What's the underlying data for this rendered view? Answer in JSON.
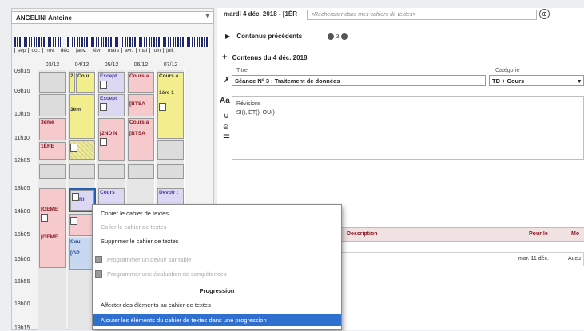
{
  "student": {
    "name": "ANGELINI Antoine"
  },
  "months": [
    "sep",
    "oct.",
    "nov.",
    "déc.",
    "janv.",
    "févr.",
    "mars",
    "avr.",
    "mai",
    "juin",
    "juil."
  ],
  "times": [
    "08h15",
    "09h10",
    "10h15",
    "11h10",
    "12h05",
    "13h05",
    "14h00",
    "15h05",
    "16h00",
    "16h55",
    "18h00",
    "19h15"
  ],
  "days": [
    "03/12",
    "04/12",
    "05/12",
    "06/12",
    "07/12"
  ],
  "cells": {
    "c1": "Cour",
    "c2": "Except",
    "c3": "Cours a",
    "c4": "Cours a",
    "c5": "Except",
    "c6": "[BTSA",
    "c7": "1ère 1",
    "c8": "3èm",
    "c9": "Cours a",
    "c10": "[2ND N",
    "c11": "[BTSA",
    "c12": "3ème",
    "c13": "1ÈRE",
    "c14": "Cours i",
    "c15": "Devoir :",
    "c16": "[GEME",
    "c17": "[GEME",
    "c18": "Cou",
    "c19": "[GP",
    "c20": "RI",
    "c21": "2",
    "c22": "1"
  },
  "header": {
    "date_title": "mardi 4 déc. 2018 - [1ÈR",
    "search_placeholder": "<Rechercher dans mes cahiers de textes>"
  },
  "contents": {
    "previous_label": "Contenus précédents",
    "previous_count": "3",
    "current_label": "Contenus du 4 déc. 2018",
    "title_label": "Titre",
    "title_value": "Séance N° 3 : Traitement de données",
    "category_label": "Catégorie",
    "category_value": "TD + Cours",
    "body_lines": [
      "Révisions",
      "SI(), ET(), OU()"
    ]
  },
  "table": {
    "col_description": "Description",
    "col_due": "Pour le",
    "col_mode": "Mo",
    "row_due": "mar. 11 déc.",
    "row_mode": "Aucu"
  },
  "menu": {
    "copy": "Copier le cahier de textes",
    "paste": "Coller le cahier de textes",
    "delete": "Supprimer le cahier de textes",
    "schedule_homework": "Programmer un devoir sur table",
    "schedule_assessment": "Programmer une évaluation de compétences",
    "progression_heading": "Progression",
    "assign": "Affecter des éléments au cahier de textes",
    "add_to_progression": "Ajouter les éléments du cahier de textes dans une progression"
  },
  "colors": {
    "highlight": "#2f6fd0",
    "pink": "#f6c9cd",
    "yellow": "#f2ee8d",
    "lavender": "#dcd8f4"
  }
}
